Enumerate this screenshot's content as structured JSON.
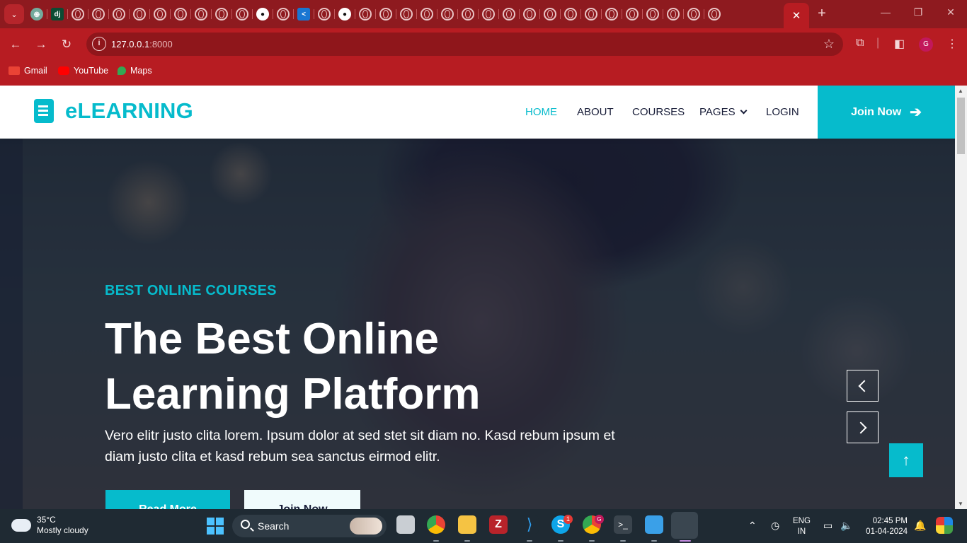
{
  "browser": {
    "active_tab_close": "✕",
    "new_tab": "+",
    "window_controls": [
      "—",
      "❐",
      "✕"
    ],
    "tab_menu": "⌄",
    "address": {
      "host": "127.0.0.1",
      "port": ":8000"
    },
    "profile_initial": "G",
    "bookmarks": [
      {
        "label": "Gmail",
        "icon": "gmail-icon",
        "color": "#ea4335"
      },
      {
        "label": "YouTube",
        "icon": "youtube-icon",
        "color": "#ff0000"
      },
      {
        "label": "Maps",
        "icon": "maps-icon",
        "color": "#34a853"
      }
    ],
    "tab_favicons": [
      "chatgpt",
      "django",
      "globe",
      "globe",
      "globe",
      "globe",
      "globe",
      "globe",
      "globe",
      "globe",
      "globe",
      "github",
      "globe",
      "share",
      "globe",
      "github",
      "globe",
      "globe",
      "globe",
      "globe",
      "globe",
      "globe",
      "globe",
      "globe",
      "globe",
      "globe",
      "globe",
      "globe",
      "globe",
      "globe",
      "globe",
      "globe",
      "globe",
      "globe"
    ]
  },
  "site": {
    "brand": "eLEARNING",
    "accent_color": "#06bbcc",
    "nav": [
      {
        "label": "HOME",
        "active": true
      },
      {
        "label": "ABOUT",
        "active": false
      },
      {
        "label": "COURSES",
        "active": false
      },
      {
        "label": "PAGES",
        "active": false,
        "dropdown": true
      },
      {
        "label": "LOGIN",
        "active": false
      }
    ],
    "join_button": "Join Now",
    "join_arrow": "➔",
    "hero": {
      "kicker": "BEST ONLINE COURSES",
      "headline_line1": "The Best Online",
      "headline_line2": "Learning Platform",
      "description": "Vero elitr justo clita lorem. Ipsum dolor at sed stet sit diam no. Kasd rebum ipsum et diam justo clita et kasd rebum sea sanctus eirmod elitr.",
      "btn_primary": "Read More",
      "btn_secondary": "Join Now"
    },
    "back_to_top": "↑"
  },
  "taskbar": {
    "weather_temp": "35°C",
    "weather_desc": "Mostly cloudy",
    "search_label": "Search",
    "lang_line1": "ENG",
    "lang_line2": "IN",
    "time": "02:45 PM",
    "date": "01-04-2024",
    "skype_badge": "1",
    "chrome_badge": "G"
  }
}
